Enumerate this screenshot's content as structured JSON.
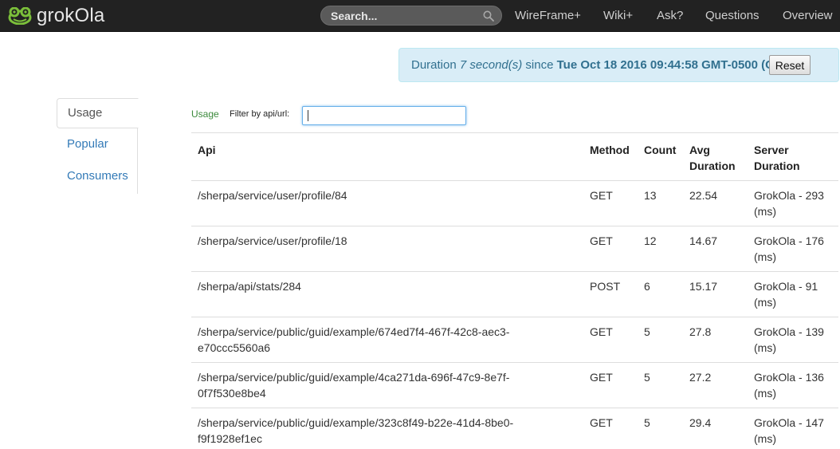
{
  "brand": {
    "name": "grokOla",
    "logo_icon": "frog-logo-icon",
    "logo_color": "#7bbf3a"
  },
  "search": {
    "placeholder": "Search...",
    "icon": "search-icon"
  },
  "nav": {
    "links": [
      "WireFrame+",
      "Wiki+",
      "Ask?",
      "Questions",
      "Overview"
    ]
  },
  "alert": {
    "prefix": "Duration ",
    "duration": "7 second(s)",
    "since_label": " since ",
    "since_date": "Tue Oct 18 2016 09:44:58 GMT-0500 (CDT)",
    "reset_label": "Reset"
  },
  "sidenav": {
    "items": [
      {
        "label": "Usage",
        "active": true
      },
      {
        "label": "Popular",
        "active": false
      },
      {
        "label": "Consumers",
        "active": false
      }
    ]
  },
  "filter": {
    "section_label": "Usage",
    "label": "Filter by api/url:",
    "value": ""
  },
  "table": {
    "headers": {
      "api": "Api",
      "method": "Method",
      "count": "Count",
      "avg": "Avg Duration",
      "server": "Server Duration"
    },
    "rows": [
      {
        "api": "/sherpa/service/user/profile/84",
        "method": "GET",
        "count": "13",
        "avg": "22.54",
        "server": "GrokOla - 293 (ms)"
      },
      {
        "api": "/sherpa/service/user/profile/18",
        "method": "GET",
        "count": "12",
        "avg": "14.67",
        "server": "GrokOla - 176 (ms)"
      },
      {
        "api": "/sherpa/api/stats/284",
        "method": "POST",
        "count": "6",
        "avg": "15.17",
        "server": "GrokOla - 91 (ms)"
      },
      {
        "api": "/sherpa/service/public/guid/example/674ed7f4-467f-42c8-aec3-e70ccc5560a6",
        "method": "GET",
        "count": "5",
        "avg": "27.8",
        "server": "GrokOla - 139 (ms)"
      },
      {
        "api": "/sherpa/service/public/guid/example/4ca271da-696f-47c9-8e7f-0f7f530e8be4",
        "method": "GET",
        "count": "5",
        "avg": "27.2",
        "server": "GrokOla - 136 (ms)"
      },
      {
        "api": "/sherpa/service/public/guid/example/323c8f49-b22e-41d4-8be0-f9f1928ef1ec",
        "method": "GET",
        "count": "5",
        "avg": "29.4",
        "server": "GrokOla - 147 (ms)"
      }
    ]
  }
}
